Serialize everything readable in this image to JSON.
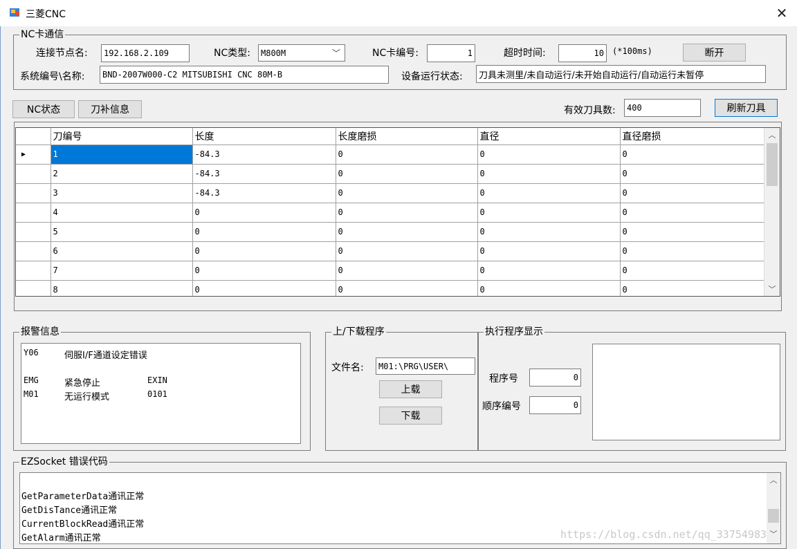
{
  "window": {
    "title": "三菱CNC",
    "close": "✕"
  },
  "comm": {
    "legend": "NC卡通信",
    "node_label": "连接节点名:",
    "node_value": "192.168.2.109",
    "nctype_label": "NC类型:",
    "nctype_value": "M800M",
    "card_no_label": "NC卡编号:",
    "card_no_value": "1",
    "timeout_label": "超时时间:",
    "timeout_value": "10",
    "timeout_unit": "(*100ms)",
    "disconnect_button": "断开",
    "sysname_label": "系统编号\\名称:",
    "sysname_value": "BND-2007W000-C2 MITSUBISHI CNC 80M-B",
    "status_label": "设备运行状态:",
    "status_value": "刀具未测里/未自动运行/未开始自动运行/自动运行未暂停"
  },
  "tabs": {
    "nc_status": "NC状态",
    "tool_offset": "刀补信息"
  },
  "tools": {
    "count_label": "有效刀具数:",
    "count_value": "400",
    "refresh_button": "刷新刀具",
    "columns": [
      "刀编号",
      "长度",
      "长度磨损",
      "直径",
      "直径磨损"
    ],
    "rows": [
      [
        "1",
        "-84.3",
        "0",
        "0",
        "0"
      ],
      [
        "2",
        "-84.3",
        "0",
        "0",
        "0"
      ],
      [
        "3",
        "-84.3",
        "0",
        "0",
        "0"
      ],
      [
        "4",
        "0",
        "0",
        "0",
        "0"
      ],
      [
        "5",
        "0",
        "0",
        "0",
        "0"
      ],
      [
        "6",
        "0",
        "0",
        "0",
        "0"
      ],
      [
        "7",
        "0",
        "0",
        "0",
        "0"
      ],
      [
        "8",
        "0",
        "0",
        "0",
        "0"
      ]
    ],
    "row_indicator": "▶"
  },
  "alarm": {
    "legend": "报警信息",
    "rows": [
      {
        "code": "Y06",
        "message": "伺服I/F通道设定错误",
        "extra": ""
      },
      {
        "code": "EMG",
        "message": "紧急停止",
        "extra": "EXIN"
      },
      {
        "code": "M01",
        "message": "无运行模式",
        "extra": "0101"
      }
    ]
  },
  "transfer": {
    "legend": "上/下载程序",
    "file_label": "文件名:",
    "file_value": "M01:\\PRG\\USER\\",
    "upload_button": "上载",
    "download_button": "下载"
  },
  "program": {
    "legend": "执行程序显示",
    "prog_no_label": "程序号",
    "prog_no_value": "0",
    "seq_no_label": "顺序编号",
    "seq_no_value": "0"
  },
  "ezsocket": {
    "legend": "EZSocket 错误代码",
    "lines": [
      "GetParameterData通讯正常",
      "GetDisTance通讯正常",
      "CurrentBlockRead通讯正常",
      "GetAlarm通讯正常"
    ]
  },
  "watermark": "https://blog.csdn.net/qq_33754983",
  "icons": {
    "close": "close-icon",
    "scroll_up": "chevron-up-icon",
    "scroll_down": "chevron-down-icon",
    "combo": "chevron-down-icon"
  }
}
